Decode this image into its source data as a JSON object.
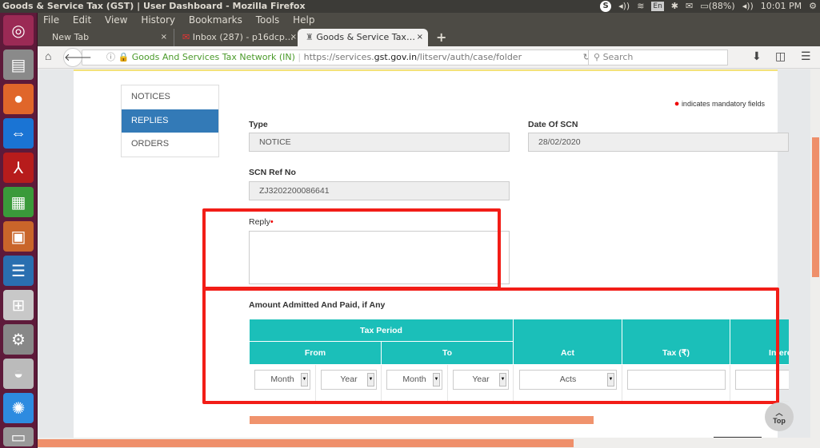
{
  "os": {
    "window_title": "Goods & Service Tax (GST) | User Dashboard - Mozilla Firefox",
    "tray": {
      "skype": "S",
      "volume": "◂))",
      "wifi": "wifi",
      "keyboard": "En",
      "bluetooth": "✱",
      "mail": "✉",
      "battery": "(88%)",
      "volume2": "◂))",
      "time": "10:01 PM",
      "power": "⚙"
    },
    "launcher": [
      "ubuntu-dash",
      "files",
      "firefox",
      "teamviewer",
      "acrobat-reader",
      "libreoffice-calc",
      "libreoffice-impress",
      "libreoffice-writer",
      "software-center",
      "system-settings",
      "disk",
      "splash-app",
      "trash"
    ]
  },
  "browser": {
    "menu": [
      "File",
      "Edit",
      "View",
      "History",
      "Bookmarks",
      "Tools",
      "Help"
    ],
    "tabs": [
      {
        "label": "New Tab",
        "close": "×"
      },
      {
        "label": "Inbox (287) - p16dcp…",
        "close": "×",
        "icon": "gmail-icon"
      },
      {
        "label": "Goods & Service Tax…",
        "close": "×",
        "active": true,
        "icon": "emblem-icon"
      }
    ],
    "new_tab": "+",
    "identity": "Goods And Services Tax Network (IN)",
    "url_prefix": "https://services.",
    "url_domain": "gst.gov.in",
    "url_path": "/litserv/auth/case/folder",
    "reload": "↻",
    "search_placeholder": "Search"
  },
  "page": {
    "sidenav": [
      "NOTICES",
      "REPLIES",
      "ORDERS"
    ],
    "mandatory_note": "indicates mandatory fields",
    "type_label": "Type",
    "type_value": "NOTICE",
    "date_label": "Date Of SCN",
    "date_value": "28/02/2020",
    "scn_label": "SCN Ref No",
    "scn_value": "ZJ3202200086641",
    "reply_label": "Reply",
    "reply_value": "",
    "amount_heading": "Amount Admitted And Paid, if Any",
    "table": {
      "tax_period": "Tax Period",
      "from": "From",
      "to": "To",
      "act": "Act",
      "tax": "Tax (₹)",
      "interest": "Interest",
      "from_month": "Month",
      "from_year": "Year",
      "to_month": "Month",
      "to_year": "Year",
      "act_value": "Acts"
    },
    "top_button": "Top"
  }
}
